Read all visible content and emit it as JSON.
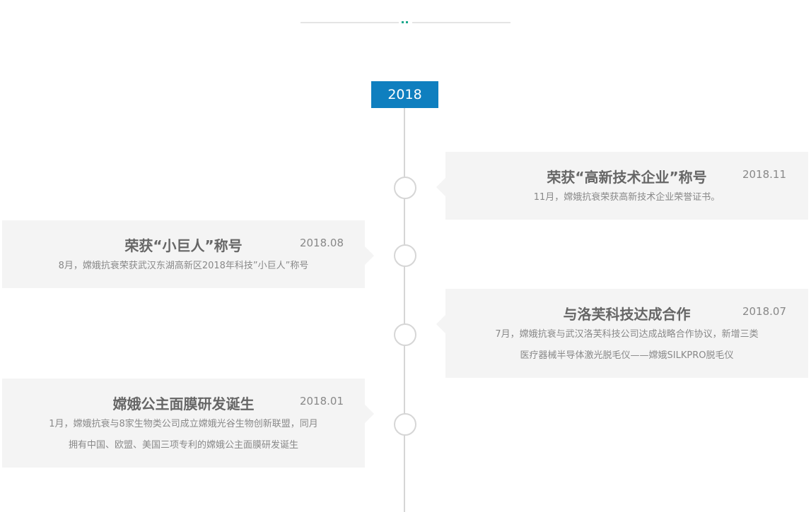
{
  "year": "2018",
  "events": [
    {
      "title": "荣获“高新技术企业”称号",
      "date": "2018.11",
      "lines": [
        "11月，嫦娥抗衰荣获高新技术企业荣誉证书。"
      ]
    },
    {
      "title": "荣获“小巨人”称号",
      "date": "2018.08",
      "lines": [
        "8月，嫦娥抗衰荣获武汉东湖高新区2018年科技”小巨人”称号"
      ]
    },
    {
      "title": "与洛芙科技达成合作",
      "date": "2018.07",
      "lines": [
        "7月，嫦娥抗衰与武汉洛芙科技公司达成战略合作协议，新增三类",
        "医疗器械半导体激光脱毛仪——嫦娥SILKPRO脱毛仪"
      ]
    },
    {
      "title": "嫦娥公主面膜研发诞生",
      "date": "2018.01",
      "lines": [
        "1月，嫦娥抗衰与8家生物类公司成立嫦娥光谷生物创新联盟，同月",
        "拥有中国、欧盟、美国三项专利的嫦娥公主面膜研发诞生"
      ]
    }
  ]
}
